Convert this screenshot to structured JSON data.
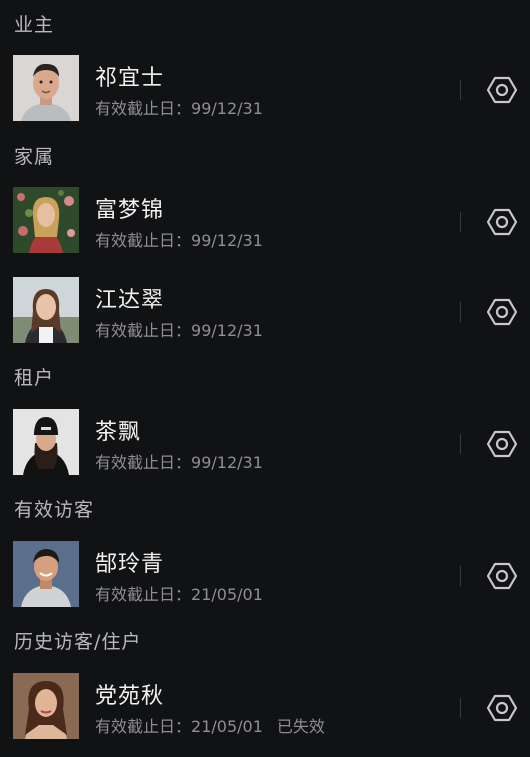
{
  "sections": {
    "owner": "业主",
    "family": "家属",
    "tenant": "租户",
    "visitor": "有效访客",
    "history": "历史访客/住户"
  },
  "expiry_label": "有效截止日：",
  "people": [
    {
      "name": "祁宜士",
      "expiry": "99/12/31",
      "status": ""
    },
    {
      "name": "富梦锦",
      "expiry": "99/12/31",
      "status": ""
    },
    {
      "name": "江达翠",
      "expiry": "99/12/31",
      "status": ""
    },
    {
      "name": "茶飘",
      "expiry": "99/12/31",
      "status": ""
    },
    {
      "name": "郜玲青",
      "expiry": "21/05/01",
      "status": ""
    },
    {
      "name": "党苑秋",
      "expiry": "21/05/01",
      "status": "已失效"
    }
  ],
  "icons": {
    "settings": "hexagon-settings-icon"
  },
  "colors": {
    "background": "#111214",
    "section_text": "#b9b9bd",
    "name_text": "#f1f1f1",
    "secondary_text": "#8e8e93",
    "icon": "#c8c8cc"
  }
}
